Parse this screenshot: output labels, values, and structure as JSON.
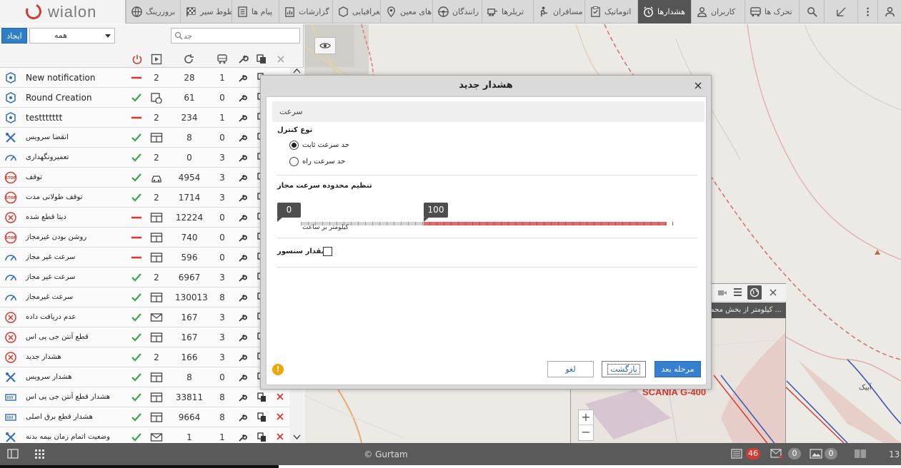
{
  "app": {
    "logo_text": "wialon",
    "brand_color": "#d33b32"
  },
  "nav": [
    {
      "label": "",
      "icon": "more-vert-icon"
    },
    {
      "label": "",
      "icon": "ruler-icon"
    },
    {
      "label": "",
      "icon": "search-icon"
    },
    {
      "label": "تحرک ها",
      "icon": "truck-icon"
    },
    {
      "label": "کاربران",
      "icon": "user-icon"
    },
    {
      "label": "هشدارها",
      "icon": "alarm-clock-icon",
      "active": true
    },
    {
      "label": "اتوماتیک",
      "icon": "clipboard-check-icon"
    },
    {
      "label": "مسافران",
      "icon": "passenger-icon"
    },
    {
      "label": "تریلرها",
      "icon": "trailer-icon"
    },
    {
      "label": "رانندگان",
      "icon": "steering-wheel-icon"
    },
    {
      "label": "های معین",
      "icon": "map-pin-icon"
    },
    {
      "label": "جغرافیایی",
      "icon": "geofence-icon"
    },
    {
      "label": "گزارشات",
      "icon": "report-icon"
    },
    {
      "label": "پیام ها",
      "icon": "messages-icon"
    },
    {
      "label": "خطوط سیر",
      "icon": "checkered-flag-icon"
    },
    {
      "label": "بروزرینگ",
      "icon": "globe-icon"
    }
  ],
  "left": {
    "create_label": "ایجاد",
    "filter_value": "همه",
    "search_placeholder": "جستجو"
  },
  "rows": [
    {
      "name": "New notification",
      "icon": "geofence-icon",
      "state": "off",
      "type_value": "2",
      "count": "28",
      "units": "1",
      "deletable": false
    },
    {
      "name": "Round Creation",
      "icon": "geofence-icon",
      "state": "on",
      "type": "sensor-icon",
      "count": "61",
      "units": "0",
      "deletable": false
    },
    {
      "name": "testtttttt",
      "icon": "geofence-icon",
      "state": "off",
      "type_value": "2",
      "count": "234",
      "units": "1",
      "deletable": false
    },
    {
      "name": "انقضا سرویس",
      "icon": "tools-icon",
      "state": "on",
      "type": "window-icon",
      "count": "8",
      "units": "0",
      "deletable": false
    },
    {
      "name": "تعمیرونگهداری",
      "icon": "speedometer-icon",
      "state": "on",
      "type_value": "2",
      "count": "0",
      "units": "3",
      "deletable": false
    },
    {
      "name": "توقف",
      "icon": "stop-sign-icon",
      "state": "on",
      "type": "car-icon",
      "count": "4954",
      "units": "3",
      "deletable": false
    },
    {
      "name": "توقف طولانی مدت",
      "icon": "stop-sign-icon",
      "state": "on",
      "type_value": "2",
      "count": "1714",
      "units": "3",
      "deletable": false
    },
    {
      "name": "دیتا قطع شده",
      "icon": "no-signal-icon",
      "state": "off",
      "type": "window-icon",
      "count": "12224",
      "units": "0",
      "deletable": false
    },
    {
      "name": "روشن بودن غیرمجاز",
      "icon": "stop-sign-icon",
      "state": "off",
      "type": "window-icon",
      "count": "740",
      "units": "0",
      "deletable": false
    },
    {
      "name": "سرعت غیر مجاز",
      "icon": "speedometer-icon",
      "state": "off",
      "type": "window-icon",
      "count": "596",
      "units": "0",
      "deletable": false
    },
    {
      "name": "سرعت غیر مجاز",
      "icon": "speedometer-icon",
      "state": "on",
      "type_value": "2",
      "count": "6967",
      "units": "3",
      "deletable": false
    },
    {
      "name": "سرعت غیرمجاز",
      "icon": "speedometer-icon",
      "state": "on",
      "type": "window-icon",
      "count": "130013",
      "units": "8",
      "deletable": false
    },
    {
      "name": "عدم دریافت داده",
      "icon": "no-signal-icon",
      "state": "on",
      "type": "mail-icon",
      "count": "167",
      "units": "3",
      "deletable": false
    },
    {
      "name": "قطع آنتن جی پی اس",
      "icon": "no-signal-icon",
      "state": "on",
      "type": "window-icon",
      "count": "167",
      "units": "3",
      "deletable": false
    },
    {
      "name": "هشدار جدید",
      "icon": "no-signal-icon",
      "state": "on",
      "type_value": "2",
      "count": "166",
      "units": "3",
      "deletable": false
    },
    {
      "name": "هشدار سرویس",
      "icon": "tools-icon",
      "state": "on",
      "type": "window-icon",
      "count": "8",
      "units": "0",
      "deletable": false
    },
    {
      "name": "هشدار قطع آنتن جی پی اس",
      "icon": "battery-icon",
      "state": "on",
      "type": "window-icon",
      "count": "33811",
      "units": "8",
      "deletable": true
    },
    {
      "name": "هشدار قطع برق اصلی",
      "icon": "battery-icon",
      "state": "on",
      "type": "window-icon",
      "count": "9664",
      "units": "8",
      "deletable": true
    },
    {
      "name": "وضعیت اتمام زمان بیمه بدنه",
      "icon": "tools-icon",
      "state": "on",
      "type": "mail-icon",
      "count": "1",
      "units": "1",
      "deletable": true
    }
  ],
  "map": {
    "popup_text": "... کیلومتر از بخش محم",
    "vehicle_label": "SCANIA G-400",
    "place_label": "آبیک",
    "zoom_in": "+",
    "zoom_out": "−"
  },
  "dialog": {
    "title": "هشدار جدید",
    "section": "سرعت",
    "control_type_label": "نوع کنترل",
    "radio_fixed": "حد سرعت ثابت",
    "radio_road": "حد سرعت راه",
    "range_label": "تنظیم محدوده سرعت مجاز",
    "slider_min": "0",
    "slider_max": "100",
    "slider_unit": "کیلومتر بر ساعت",
    "sensor_label": "مقدار سنسور",
    "btn_next": "مرحله بعد",
    "btn_back": "بازگشت",
    "btn_cancel": "لغو",
    "warn": "!"
  },
  "bottom": {
    "copyright": "© Gurtam",
    "badge_messages": "46",
    "badge_mail": "0",
    "badge_photo": "0",
    "time_partial": "13"
  }
}
